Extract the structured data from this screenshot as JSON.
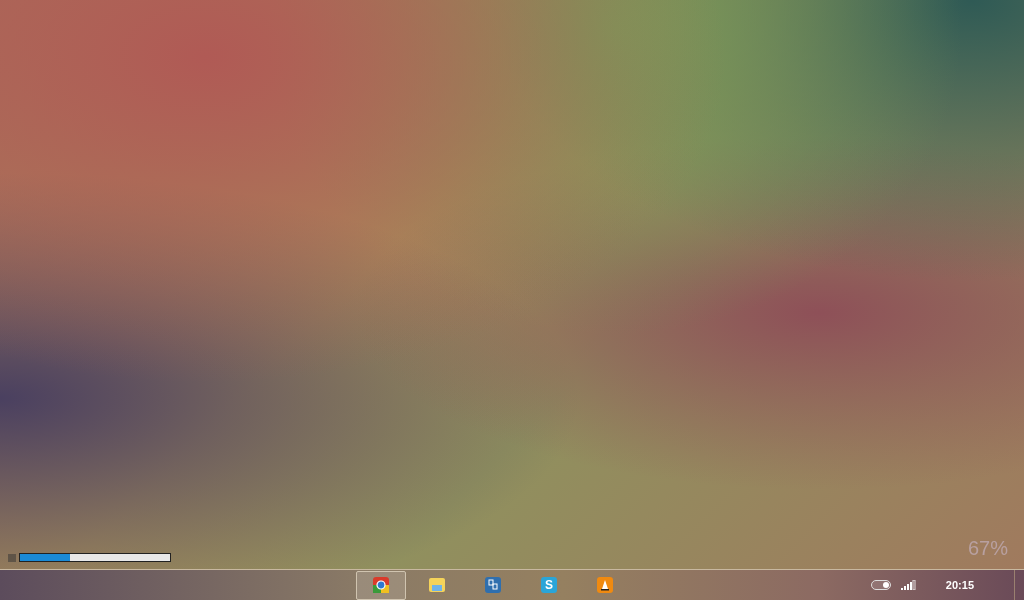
{
  "desktop": {
    "progress": {
      "level": 0.33
    },
    "battery_reading": "67%"
  },
  "taskbar": {
    "apps": [
      {
        "kind": "browser",
        "selected": true
      },
      {
        "kind": "folder",
        "selected": false
      },
      {
        "kind": "files",
        "selected": false
      },
      {
        "kind": "chat",
        "glyph": "S",
        "selected": false
      },
      {
        "kind": "player",
        "selected": false
      }
    ],
    "tray": {
      "toggle_on": true,
      "clock": "20:15"
    }
  }
}
